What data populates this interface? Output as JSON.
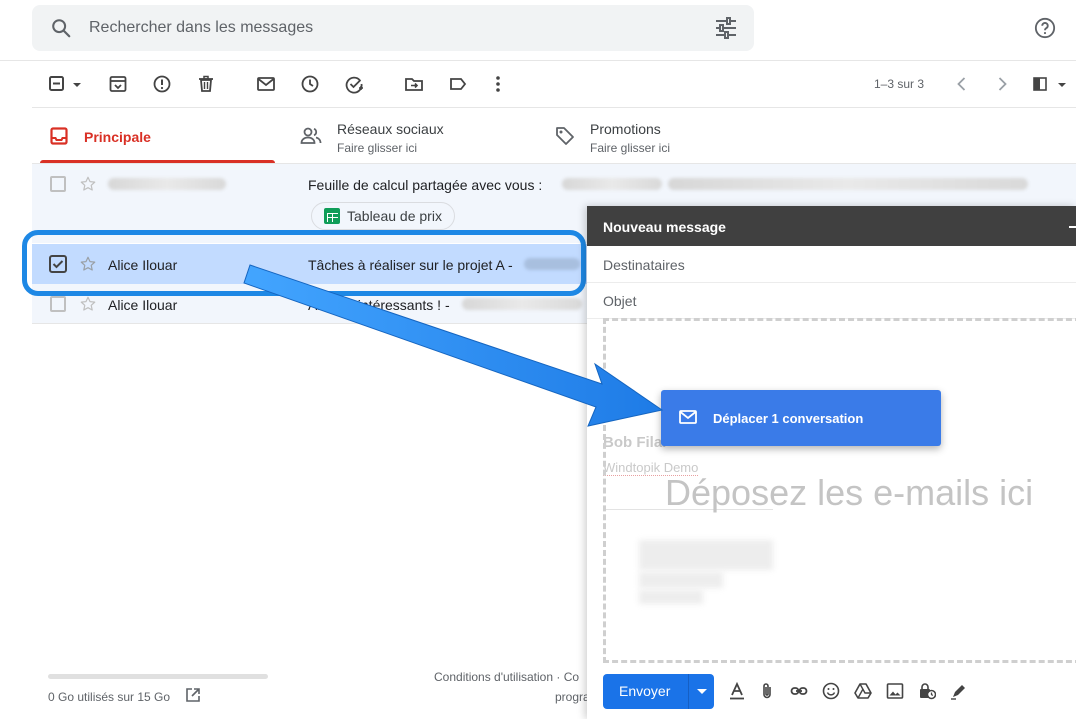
{
  "search": {
    "placeholder": "Rechercher dans les messages"
  },
  "toolbar": {
    "pager": "1–3 sur 3"
  },
  "tabs": [
    {
      "label": "Principale",
      "sub": ""
    },
    {
      "label": "Réseaux sociaux",
      "sub": "Faire glisser ici"
    },
    {
      "label": "Promotions",
      "sub": "Faire glisser ici"
    }
  ],
  "emails": [
    {
      "sender": "",
      "subject": "Feuille de calcul partagée avec vous :",
      "attachment": "Tableau de prix",
      "selected": false
    },
    {
      "sender": "Alice Ilouar",
      "subject": "Tâches à réaliser sur le projet A -",
      "selected": true
    },
    {
      "sender": "Alice Ilouar",
      "subject": "Articles intéressants ! -",
      "selected": false
    }
  ],
  "footer": {
    "storage": "0 Go utilisés sur 15 Go",
    "links": "Conditions d'utilisation · Co",
    "links2": "progra"
  },
  "compose": {
    "title": "Nouveau message",
    "to_label": "Destinataires",
    "subject_label": "Objet",
    "drop_text": "Déposez les e-mails ici",
    "ghost_name": "Bob Filar",
    "ghost_company": "Windtopik Demo",
    "send_label": "Envoyer"
  },
  "drag": {
    "label": "Déplacer 1 conversation"
  },
  "colors": {
    "accent_red": "#d93025",
    "selected_row": "#c2dbff",
    "highlight": "#1e88e5",
    "send": "#1a73e8"
  }
}
